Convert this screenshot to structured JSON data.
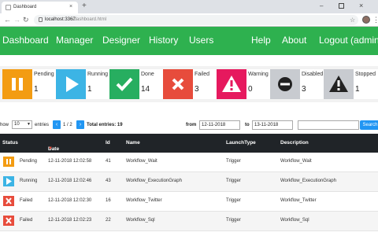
{
  "browser": {
    "tab_title": "Dashboard",
    "tab_close": "×",
    "new_tab": "+",
    "url_host": "localhost:3367",
    "url_path": "/dashboard.html",
    "min": "–",
    "close": "×"
  },
  "nav": {
    "dashboard": "Dashboard",
    "manager": "Manager",
    "designer": "Designer",
    "history": "History",
    "users": "Users",
    "help": "Help",
    "about": "About",
    "logout": "Logout (admin)"
  },
  "stats": [
    {
      "label": "Pending",
      "value": "1",
      "color": "#f39c12",
      "icon": "pause-icon"
    },
    {
      "label": "Running",
      "value": "1",
      "color": "#3cb4e5",
      "icon": "play-icon"
    },
    {
      "label": "Done",
      "value": "14",
      "color": "#27ae60",
      "icon": "check-icon"
    },
    {
      "label": "Failed",
      "value": "3",
      "color": "#e74c3c",
      "icon": "x-icon"
    },
    {
      "label": "Warning",
      "value": "0",
      "color": "#e6195e",
      "icon": "warning-icon"
    },
    {
      "label": "Disabled",
      "value": "3",
      "color": "#c8cbd0",
      "icon": "disabled-icon"
    },
    {
      "label": "Stopped",
      "value": "1",
      "color": "#c8cbd0",
      "icon": "stop-warning-icon"
    }
  ],
  "controls": {
    "show": "how",
    "page_size": "10",
    "entries": "entries",
    "page": "1 / 2",
    "total": "Total entries: 19",
    "from_label": "from",
    "from_value": "12-11-2018",
    "to_label": "to",
    "to_value": "13-11-2018",
    "search_label": "Search",
    "prev": "‹",
    "next": "›"
  },
  "table": {
    "headers": {
      "status": "Status",
      "date": "Date",
      "id": "Id",
      "name": "Name",
      "launch": "LaunchType",
      "description": "Description"
    },
    "rows": [
      {
        "status": "Pending",
        "date": "12-11-2018 12:02:58",
        "id": "41",
        "name": "Workflow_Wait",
        "launch": "Trigger",
        "description": "Workflow_Wait",
        "color": "#f39c12"
      },
      {
        "status": "Running",
        "date": "12-11-2018 12:02:46",
        "id": "43",
        "name": "Workflow_ExecutionGraph",
        "launch": "Trigger",
        "description": "Workflow_ExecutionGraph",
        "color": "#3cb4e5"
      },
      {
        "status": "Failed",
        "date": "12-11-2018 12:02:30",
        "id": "16",
        "name": "Workflow_Twitter",
        "launch": "Trigger",
        "description": "Workflow_Twitter",
        "color": "#e74c3c"
      },
      {
        "status": "Failed",
        "date": "12-11-2018 12:02:23",
        "id": "22",
        "name": "Workflow_Sql",
        "launch": "Trigger",
        "description": "Workflow_Sql",
        "color": "#e74c3c"
      }
    ]
  }
}
